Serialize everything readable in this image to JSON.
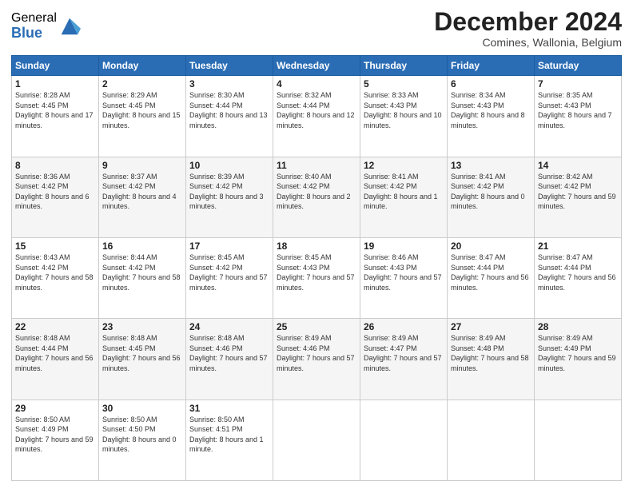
{
  "logo": {
    "general": "General",
    "blue": "Blue"
  },
  "header": {
    "month": "December 2024",
    "location": "Comines, Wallonia, Belgium"
  },
  "days_of_week": [
    "Sunday",
    "Monday",
    "Tuesday",
    "Wednesday",
    "Thursday",
    "Friday",
    "Saturday"
  ],
  "weeks": [
    [
      {
        "day": "1",
        "sunrise": "8:28 AM",
        "sunset": "4:45 PM",
        "daylight": "8 hours and 17 minutes."
      },
      {
        "day": "2",
        "sunrise": "8:29 AM",
        "sunset": "4:45 PM",
        "daylight": "8 hours and 15 minutes."
      },
      {
        "day": "3",
        "sunrise": "8:30 AM",
        "sunset": "4:44 PM",
        "daylight": "8 hours and 13 minutes."
      },
      {
        "day": "4",
        "sunrise": "8:32 AM",
        "sunset": "4:44 PM",
        "daylight": "8 hours and 12 minutes."
      },
      {
        "day": "5",
        "sunrise": "8:33 AM",
        "sunset": "4:43 PM",
        "daylight": "8 hours and 10 minutes."
      },
      {
        "day": "6",
        "sunrise": "8:34 AM",
        "sunset": "4:43 PM",
        "daylight": "8 hours and 8 minutes."
      },
      {
        "day": "7",
        "sunrise": "8:35 AM",
        "sunset": "4:43 PM",
        "daylight": "8 hours and 7 minutes."
      }
    ],
    [
      {
        "day": "8",
        "sunrise": "8:36 AM",
        "sunset": "4:42 PM",
        "daylight": "8 hours and 6 minutes."
      },
      {
        "day": "9",
        "sunrise": "8:37 AM",
        "sunset": "4:42 PM",
        "daylight": "8 hours and 4 minutes."
      },
      {
        "day": "10",
        "sunrise": "8:39 AM",
        "sunset": "4:42 PM",
        "daylight": "8 hours and 3 minutes."
      },
      {
        "day": "11",
        "sunrise": "8:40 AM",
        "sunset": "4:42 PM",
        "daylight": "8 hours and 2 minutes."
      },
      {
        "day": "12",
        "sunrise": "8:41 AM",
        "sunset": "4:42 PM",
        "daylight": "8 hours and 1 minute."
      },
      {
        "day": "13",
        "sunrise": "8:41 AM",
        "sunset": "4:42 PM",
        "daylight": "8 hours and 0 minutes."
      },
      {
        "day": "14",
        "sunrise": "8:42 AM",
        "sunset": "4:42 PM",
        "daylight": "7 hours and 59 minutes."
      }
    ],
    [
      {
        "day": "15",
        "sunrise": "8:43 AM",
        "sunset": "4:42 PM",
        "daylight": "7 hours and 58 minutes."
      },
      {
        "day": "16",
        "sunrise": "8:44 AM",
        "sunset": "4:42 PM",
        "daylight": "7 hours and 58 minutes."
      },
      {
        "day": "17",
        "sunrise": "8:45 AM",
        "sunset": "4:42 PM",
        "daylight": "7 hours and 57 minutes."
      },
      {
        "day": "18",
        "sunrise": "8:45 AM",
        "sunset": "4:43 PM",
        "daylight": "7 hours and 57 minutes."
      },
      {
        "day": "19",
        "sunrise": "8:46 AM",
        "sunset": "4:43 PM",
        "daylight": "7 hours and 57 minutes."
      },
      {
        "day": "20",
        "sunrise": "8:47 AM",
        "sunset": "4:44 PM",
        "daylight": "7 hours and 56 minutes."
      },
      {
        "day": "21",
        "sunrise": "8:47 AM",
        "sunset": "4:44 PM",
        "daylight": "7 hours and 56 minutes."
      }
    ],
    [
      {
        "day": "22",
        "sunrise": "8:48 AM",
        "sunset": "4:44 PM",
        "daylight": "7 hours and 56 minutes."
      },
      {
        "day": "23",
        "sunrise": "8:48 AM",
        "sunset": "4:45 PM",
        "daylight": "7 hours and 56 minutes."
      },
      {
        "day": "24",
        "sunrise": "8:48 AM",
        "sunset": "4:46 PM",
        "daylight": "7 hours and 57 minutes."
      },
      {
        "day": "25",
        "sunrise": "8:49 AM",
        "sunset": "4:46 PM",
        "daylight": "7 hours and 57 minutes."
      },
      {
        "day": "26",
        "sunrise": "8:49 AM",
        "sunset": "4:47 PM",
        "daylight": "7 hours and 57 minutes."
      },
      {
        "day": "27",
        "sunrise": "8:49 AM",
        "sunset": "4:48 PM",
        "daylight": "7 hours and 58 minutes."
      },
      {
        "day": "28",
        "sunrise": "8:49 AM",
        "sunset": "4:49 PM",
        "daylight": "7 hours and 59 minutes."
      }
    ],
    [
      {
        "day": "29",
        "sunrise": "8:50 AM",
        "sunset": "4:49 PM",
        "daylight": "7 hours and 59 minutes."
      },
      {
        "day": "30",
        "sunrise": "8:50 AM",
        "sunset": "4:50 PM",
        "daylight": "8 hours and 0 minutes."
      },
      {
        "day": "31",
        "sunrise": "8:50 AM",
        "sunset": "4:51 PM",
        "daylight": "8 hours and 1 minute."
      },
      null,
      null,
      null,
      null
    ]
  ]
}
